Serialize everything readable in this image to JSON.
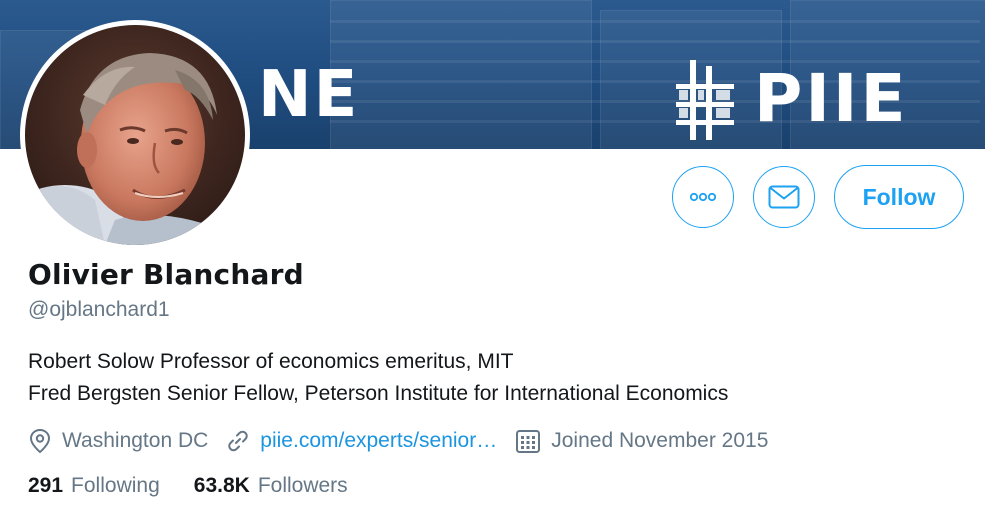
{
  "banner": {
    "left_text": "NE",
    "right_text": "PIIE",
    "background": "#1f4c7f"
  },
  "avatar": {
    "icon": "profile-photo"
  },
  "actions": {
    "more_icon": "more-icon",
    "message_icon": "envelope-icon",
    "follow_label": "Follow",
    "accent": "#1da1f2"
  },
  "profile": {
    "name": "Olivier Blanchard",
    "handle": "@ojblanchard1",
    "bio_line1": "Robert Solow Professor of economics emeritus, MIT",
    "bio_line2": "Fred Bergsten Senior Fellow, Peterson Institute for International Economics"
  },
  "meta": {
    "location": "Washington DC",
    "location_icon": "location-pin-icon",
    "website": "piie.com/experts/senior…",
    "website_icon": "link-icon",
    "joined": "Joined November 2015",
    "joined_icon": "calendar-icon"
  },
  "stats": {
    "following_count": "291",
    "following_label": "Following",
    "followers_count": "63.8K",
    "followers_label": "Followers"
  }
}
